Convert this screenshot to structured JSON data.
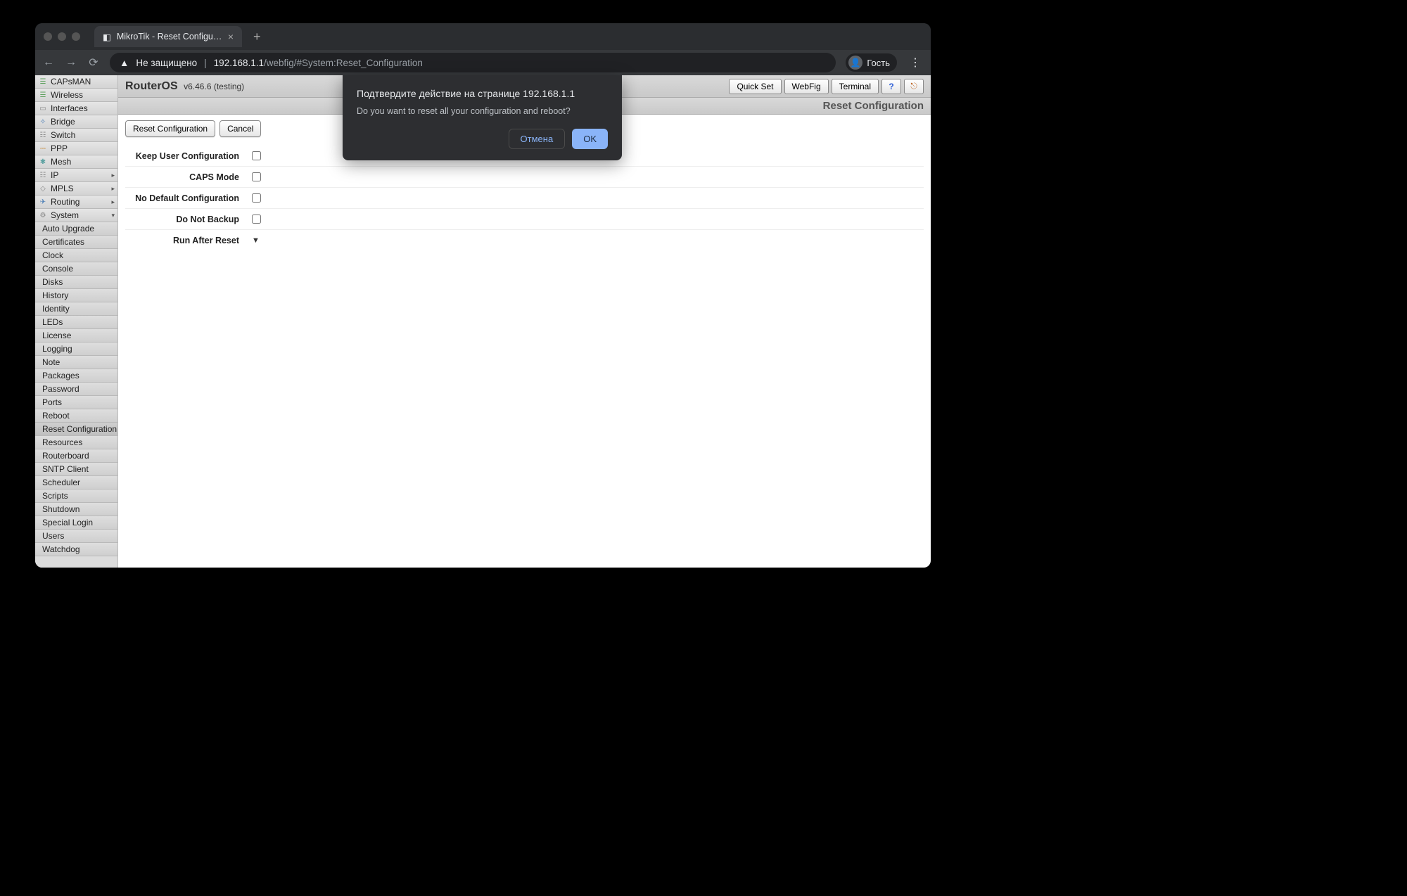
{
  "browser": {
    "tab_title": "MikroTik - Reset Configuration",
    "security_label": "Не защищено",
    "url_host": "192.168.1.1",
    "url_path": "/webfig/#System:Reset_Configuration",
    "profile_label": "Гость"
  },
  "header": {
    "brand": "RouterOS",
    "version": "v6.46.6 (testing)",
    "page_title": "Reset Configuration",
    "buttons": {
      "quickset": "Quick Set",
      "webfig": "WebFig",
      "terminal": "Terminal"
    }
  },
  "sidebar": {
    "top": [
      {
        "label": "CAPsMAN"
      },
      {
        "label": "Wireless"
      },
      {
        "label": "Interfaces"
      },
      {
        "label": "Bridge"
      },
      {
        "label": "Switch"
      },
      {
        "label": "PPP"
      },
      {
        "label": "Mesh"
      },
      {
        "label": "IP",
        "arrow": true
      },
      {
        "label": "MPLS",
        "arrow": true
      },
      {
        "label": "Routing",
        "arrow": true
      },
      {
        "label": "System",
        "arrow": true,
        "expanded": true
      }
    ],
    "system": [
      "Auto Upgrade",
      "Certificates",
      "Clock",
      "Console",
      "Disks",
      "History",
      "Identity",
      "LEDs",
      "License",
      "Logging",
      "Note",
      "Packages",
      "Password",
      "Ports",
      "Reboot",
      "Reset Configuration",
      "Resources",
      "Routerboard",
      "SNTP Client",
      "Scheduler",
      "Scripts",
      "Shutdown",
      "Special Login",
      "Users",
      "Watchdog"
    ],
    "system_active": "Reset Configuration"
  },
  "toolbar": {
    "reset": "Reset Configuration",
    "cancel": "Cancel"
  },
  "form": {
    "keep_user": "Keep User Configuration",
    "caps_mode": "CAPS Mode",
    "no_default": "No Default Configuration",
    "do_not_backup": "Do Not Backup",
    "run_after_reset": "Run After Reset"
  },
  "dialog": {
    "title": "Подтвердите действие на странице 192.168.1.1",
    "message": "Do you want to reset all your configuration and reboot?",
    "cancel": "Отмена",
    "ok": "OK"
  }
}
